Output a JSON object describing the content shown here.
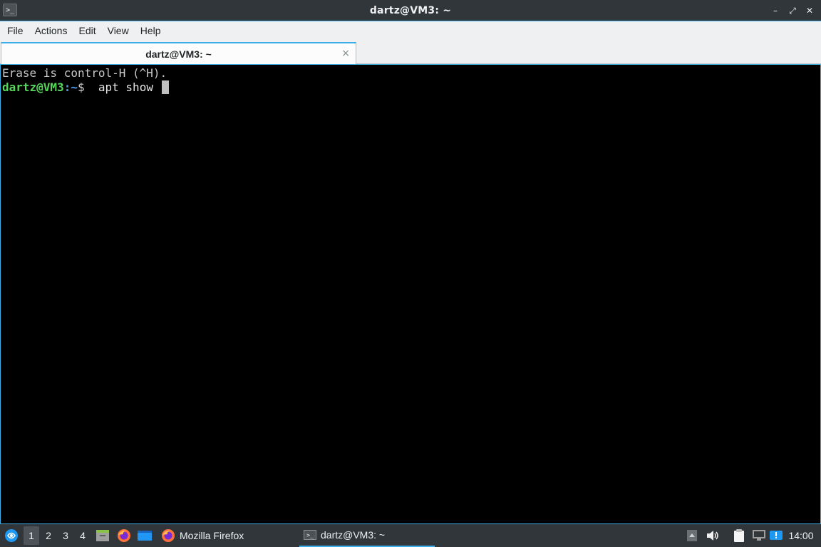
{
  "window": {
    "title": "dartz@VM3: ~",
    "app_icon_glyph": ">_",
    "buttons": {
      "minimize": "–",
      "maximize": "⤢",
      "close": "✕"
    }
  },
  "menu": [
    "File",
    "Actions",
    "Edit",
    "View",
    "Help"
  ],
  "tab": {
    "label": "dartz@VM3: ~",
    "close": "×"
  },
  "terminal": {
    "line1": "Erase is control-H (^H).",
    "prompt_user": "dartz@VM3",
    "prompt_colon": ":",
    "prompt_path": "~",
    "prompt_symbol": "$",
    "command": "  apt show "
  },
  "taskbar": {
    "workspaces": [
      "1",
      "2",
      "3",
      "4"
    ],
    "active_workspace": "1",
    "tasks": [
      {
        "label": "Mozilla Firefox",
        "icon": "firefox-icon"
      },
      {
        "label": "dartz@VM3: ~",
        "icon": "terminal-icon"
      }
    ],
    "clock": "14:00"
  },
  "colors": {
    "accent": "#3daee9",
    "prompt_user": "#55d65a",
    "prompt_path": "#4d9ee9",
    "terminal_bg": "#000000",
    "panel_bg": "#31363b"
  }
}
